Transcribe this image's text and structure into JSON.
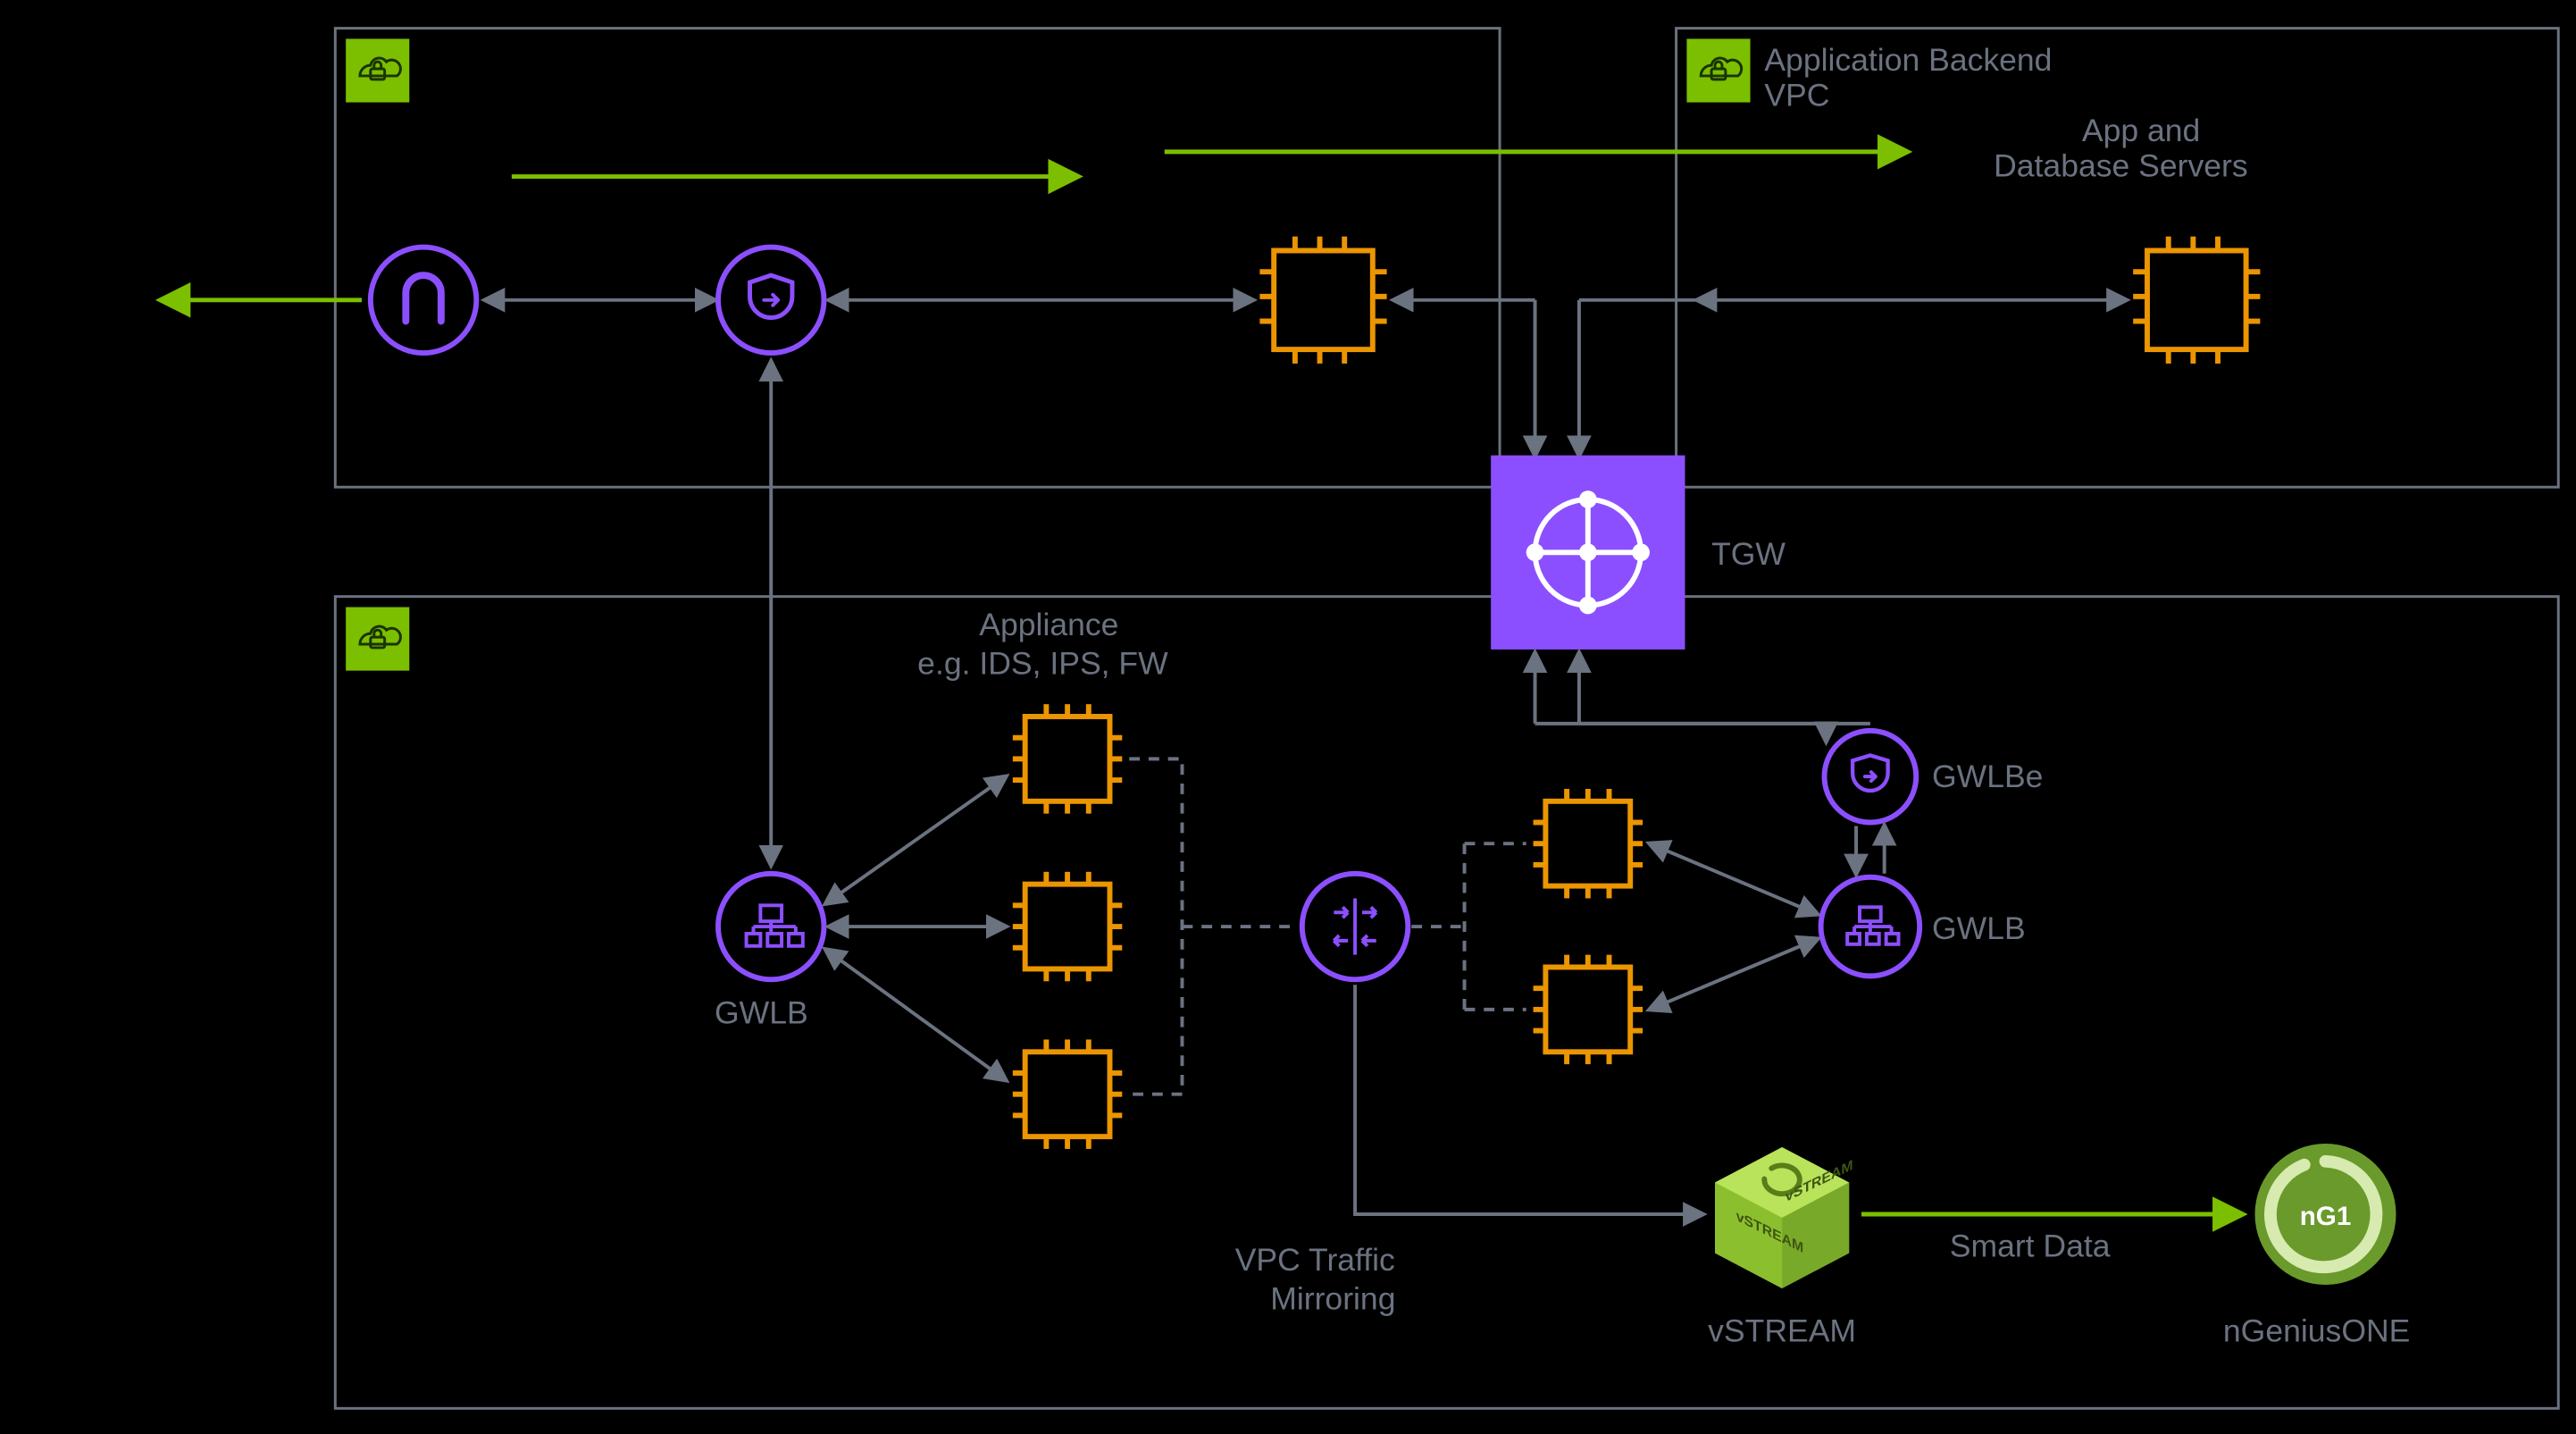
{
  "colors": {
    "bg": "#000000",
    "text": "#6b7280",
    "green": "#7bbf00",
    "greenDark": "#6aa300",
    "orange": "#eb9500",
    "orangeDark": "#c07600",
    "purple": "#8c4fff",
    "purpleFill": "#8c4fff",
    "gray": "#6b7280",
    "border": "#6b7280",
    "ngGreen": "#6a9a2b",
    "ngGreenRing": "#cfe6a3"
  },
  "vpcs": {
    "ingress": {
      "iconType": "cloud-lock"
    },
    "backend": {
      "title1": "Application Backend",
      "title2": "VPC",
      "iconType": "cloud-lock"
    },
    "security": {
      "iconType": "cloud-lock"
    }
  },
  "labels": {
    "tgw": "TGW",
    "appDb1": "App and",
    "appDb2": "Database Servers",
    "appliance1": "Appliance",
    "appliance2": "e.g. IDS, IPS, FW",
    "gwlbLeft": "GWLB",
    "gwlbRight": "GWLB",
    "gwlbe": "GWLBe",
    "mirror1": "VPC Traffic",
    "mirror2": "Mirroring",
    "vstream": "vSTREAM",
    "smartData": "Smart Data",
    "nGenius": "nGeniusONE",
    "nG1": "nG1"
  },
  "nodes": {
    "internetGate": {
      "type": "circle-purple",
      "icon": "horseshoe"
    },
    "gwlbeTop": {
      "type": "circle-purple",
      "icon": "shield-in"
    },
    "chipTopLeft": {
      "type": "chip-orange"
    },
    "chipTopRight": {
      "type": "chip-orange"
    },
    "tgw": {
      "type": "square-purple",
      "icon": "transit-hub"
    },
    "gwlbLeft": {
      "type": "circle-purple",
      "icon": "load-balancer"
    },
    "chipA1": {
      "type": "chip-orange"
    },
    "chipA2": {
      "type": "chip-orange"
    },
    "chipA3": {
      "type": "chip-orange"
    },
    "mirror": {
      "type": "circle-purple",
      "icon": "mirror"
    },
    "chipB1": {
      "type": "chip-orange"
    },
    "chipB2": {
      "type": "chip-orange"
    },
    "gwlbRight": {
      "type": "circle-purple",
      "icon": "load-balancer"
    },
    "gwlbeRight": {
      "type": "circle-purple",
      "icon": "shield-in"
    },
    "vstream": {
      "type": "cube-green",
      "faceLabel": "vSTREAM"
    },
    "ngenius": {
      "type": "ring-green",
      "centerLabel": "nG1"
    }
  }
}
